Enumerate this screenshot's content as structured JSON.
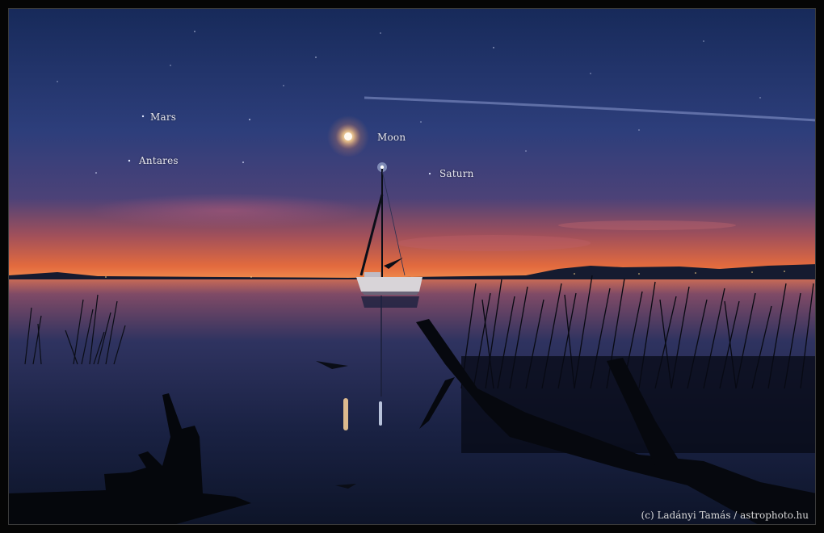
{
  "labels": {
    "mars": "Mars",
    "antares": "Antares",
    "moon": "Moon",
    "saturn": "Saturn"
  },
  "credit": "(c) Ladányi Tamás / astrophoto.hu",
  "colors": {
    "sky_top": "#1c2f63",
    "sky_mid": "#2e3f7a",
    "horizon_glow": "#e0643c",
    "water": "#1a2344",
    "silhouette": "#06080e",
    "label_text": "#e8e8f0"
  }
}
